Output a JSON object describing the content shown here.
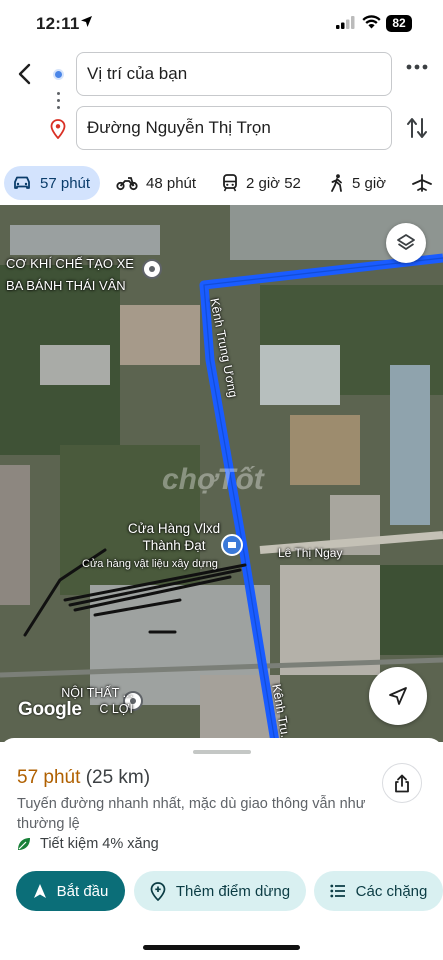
{
  "status_bar": {
    "time": "12:11",
    "battery": "82"
  },
  "search": {
    "origin": "Vị trí của bạn",
    "destination": "Đường Nguyễn Thị Trọn"
  },
  "travel_modes": [
    {
      "icon": "car-icon",
      "label": "57 phút",
      "selected": true
    },
    {
      "icon": "motorbike-icon",
      "label": "48 phút"
    },
    {
      "icon": "transit-icon",
      "label": "2 giờ 52"
    },
    {
      "icon": "walk-icon",
      "label": "5 giờ"
    },
    {
      "icon": "flight-icon",
      "label": ""
    }
  ],
  "map": {
    "places": [
      {
        "label": "CƠ KHÍ CHẾ TẠO XE BA BÁNH THÁI VÂN"
      },
      {
        "label": "Cửa Hàng Vlxd Thành Đạt"
      },
      {
        "label": "Cửa hàng vật liệu xây dựng"
      },
      {
        "label": "NỘI THẤT ... C LỢI"
      }
    ],
    "roads": [
      "Kênh Trung Ương",
      "Lê Thị Ngay",
      "Kênh Tru..."
    ],
    "logo": "Google",
    "watermark": "chợTốt",
    "route_color": "#1a5cff"
  },
  "route": {
    "duration": "57 phút",
    "distance": "(25 km)",
    "description": "Tuyến đường nhanh nhất, mặc dù giao thông vẫn như thường lệ",
    "eco": "Tiết kiệm 4% xăng"
  },
  "actions": {
    "start": "Bắt đầu",
    "add_stop": "Thêm điểm dừng",
    "steps": "Các chặng"
  },
  "colors": {
    "primary": "#0b6e78",
    "chip": "#d9f0f1",
    "mode_active": "#d3e3fd",
    "duration": "#b06000"
  }
}
